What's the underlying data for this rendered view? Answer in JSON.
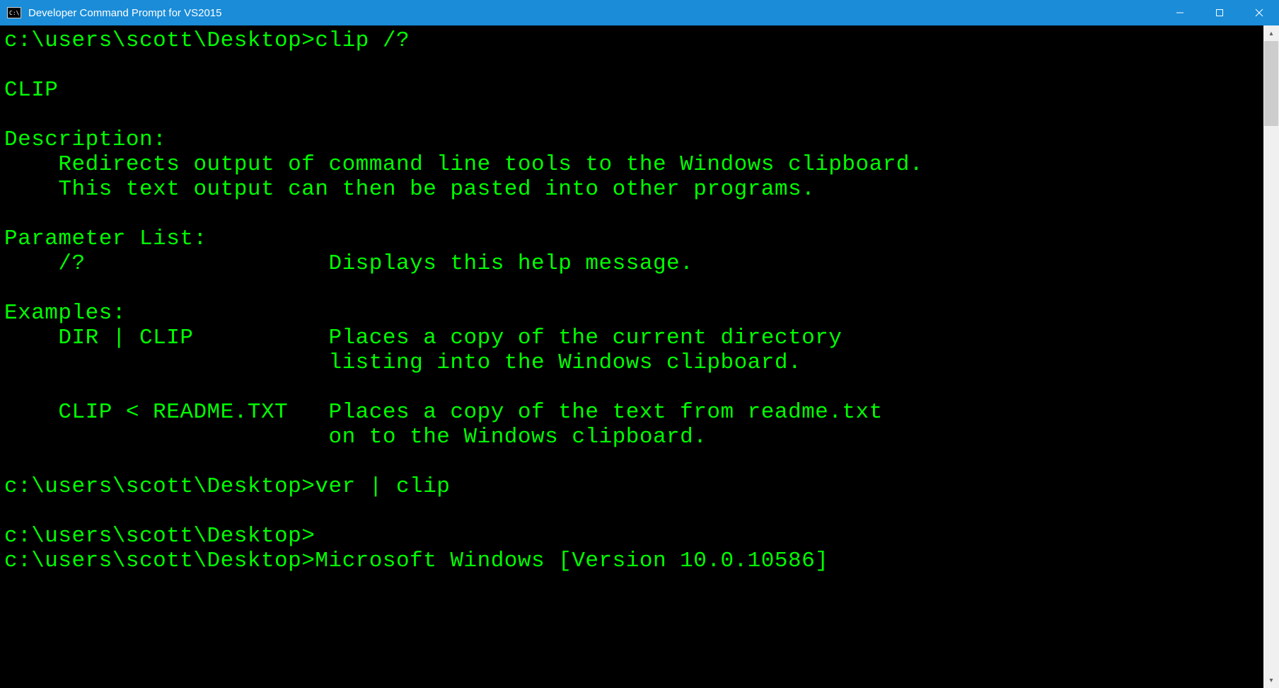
{
  "window": {
    "title": "Developer Command Prompt for VS2015"
  },
  "terminal": {
    "lines": [
      {
        "prompt": "c:\\users\\scott\\Desktop>",
        "command": "clip /?"
      },
      {
        "text": ""
      },
      {
        "text": "CLIP"
      },
      {
        "text": ""
      },
      {
        "text": "Description:"
      },
      {
        "text": "    Redirects output of command line tools to the Windows clipboard."
      },
      {
        "text": "    This text output can then be pasted into other programs."
      },
      {
        "text": ""
      },
      {
        "text": "Parameter List:"
      },
      {
        "text": "    /?                  Displays this help message."
      },
      {
        "text": ""
      },
      {
        "text": "Examples:"
      },
      {
        "text": "    DIR | CLIP          Places a copy of the current directory"
      },
      {
        "text": "                        listing into the Windows clipboard."
      },
      {
        "text": ""
      },
      {
        "text": "    CLIP < README.TXT   Places a copy of the text from readme.txt"
      },
      {
        "text": "                        on to the Windows clipboard."
      },
      {
        "text": ""
      },
      {
        "prompt": "c:\\users\\scott\\Desktop>",
        "command": "ver | clip"
      },
      {
        "text": ""
      },
      {
        "prompt": "c:\\users\\scott\\Desktop>",
        "command": ""
      },
      {
        "prompt": "c:\\users\\scott\\Desktop>",
        "command": "Microsoft Windows [Version 10.0.10586]"
      }
    ]
  }
}
